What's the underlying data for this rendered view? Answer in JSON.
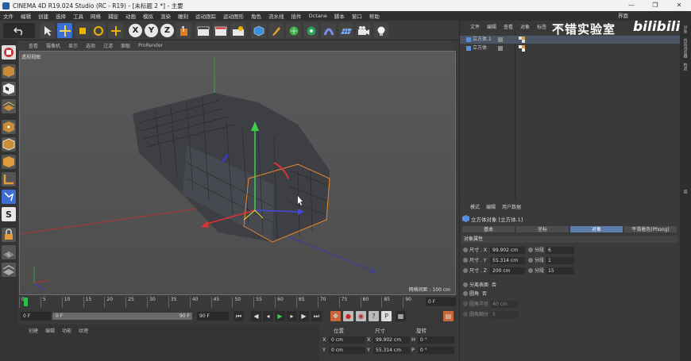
{
  "window": {
    "title": "CINEMA 4D R19.024 Studio (RC - R19) - [未标题 2 *] - 主要",
    "controls": [
      "—",
      "❐",
      "✕"
    ]
  },
  "menubar": {
    "items": [
      "文件",
      "编辑",
      "创建",
      "选择",
      "工具",
      "网格",
      "捕捉",
      "动画",
      "模拟",
      "渲染",
      "雕刻",
      "运动跟踪",
      "运动图形",
      "角色",
      "流水线",
      "插件",
      "Octane",
      "脚本",
      "窗口",
      "帮助"
    ],
    "layout_label": "界面"
  },
  "toolbar": {
    "axis_x": "X",
    "axis_y": "Y",
    "axis_z": "Z"
  },
  "viewport": {
    "menu": [
      "查看",
      "摄像机",
      "显示",
      "选项",
      "过滤",
      "面板",
      "ProRender"
    ],
    "label": "透视视图",
    "grid_distance": "网格间距 : 100 cm"
  },
  "timeline": {
    "frames": [
      "0",
      "5",
      "10",
      "15",
      "20",
      "25",
      "30",
      "35",
      "40",
      "45",
      "50",
      "55",
      "60",
      "65",
      "70",
      "75",
      "80",
      "85",
      "90"
    ],
    "end_field": "0 F"
  },
  "transport": {
    "start_field": "0 F",
    "slider_start": "0 F",
    "slider_end": "90 F",
    "end_field": "90 F"
  },
  "material_panel": {
    "menu": [
      "创建",
      "编辑",
      "功能",
      "纹理"
    ]
  },
  "coordinates": {
    "headers": [
      "位置",
      "尺寸",
      "旋转"
    ],
    "rows": [
      {
        "axis": "X",
        "pos": "0 cm",
        "size_axis": "X",
        "size": "99.902 cm",
        "rot_axis": "H",
        "rot": "0 °"
      },
      {
        "axis": "Y",
        "pos": "0 cm",
        "size_axis": "Y",
        "size": "55.314 cm",
        "rot_axis": "P",
        "rot": "0 °"
      }
    ]
  },
  "objects_panel": {
    "menu": [
      "文件",
      "编辑",
      "查看",
      "对象",
      "标签",
      "书签"
    ],
    "rows": [
      {
        "name": "立方体.1",
        "selected": true
      },
      {
        "name": "立方体",
        "selected": false
      }
    ]
  },
  "watermark": {
    "text": "不错实验室",
    "logo": "bilibili"
  },
  "sidestrip": {
    "tabs": [
      "对象",
      "内容浏览器",
      "构造",
      "层"
    ]
  },
  "attributes": {
    "menu": [
      "模式",
      "编辑",
      "用户数据"
    ],
    "object_title": "立方体对象 [立方体.1]",
    "tabs": [
      {
        "label": "基本",
        "active": false
      },
      {
        "label": "坐标",
        "active": false
      },
      {
        "label": "对象",
        "active": true
      },
      {
        "label": "平滑着色(Phong)",
        "active": false
      }
    ],
    "section": "对象属性",
    "size_rows": [
      {
        "label": "尺寸 . X",
        "value": "99.902 cm",
        "seg_label": "分段 X",
        "seg": "6"
      },
      {
        "label": "尺寸 . Y",
        "value": "55.314 cm",
        "seg_label": "分段 Y",
        "seg": "1"
      },
      {
        "label": "尺寸 . Z",
        "value": "200 cm",
        "seg_label": "分段 Z",
        "seg": "15"
      }
    ],
    "separate_label": "分离表面",
    "separate_value": "否",
    "fillet_label": "圆角",
    "fillet_value": "否",
    "fillet_radius_label": "圆角半径",
    "fillet_radius_value": "40 cm",
    "fillet_sub_label": "圆角细分",
    "fillet_sub_value": "5"
  }
}
